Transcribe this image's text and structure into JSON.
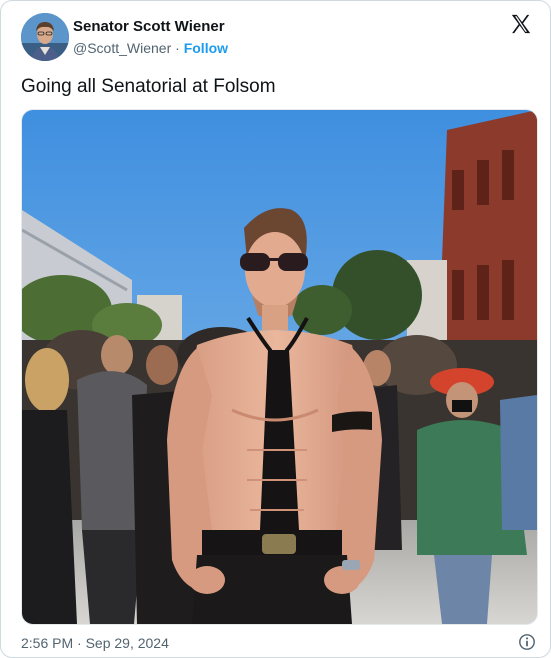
{
  "author": {
    "display_name": "Senator Scott Wiener",
    "handle": "@Scott_Wiener",
    "separator": "·",
    "follow_label": "Follow"
  },
  "post": {
    "text": "Going all Senatorial at Folsom",
    "timestamp": "2:56 PM · Sep 29, 2024"
  },
  "icons": {
    "brand": "x-logo-icon",
    "info": "info-icon"
  },
  "colors": {
    "accent": "#1d9bf0",
    "text": "#0f1419",
    "muted": "#536471",
    "border": "#cfd9de"
  }
}
